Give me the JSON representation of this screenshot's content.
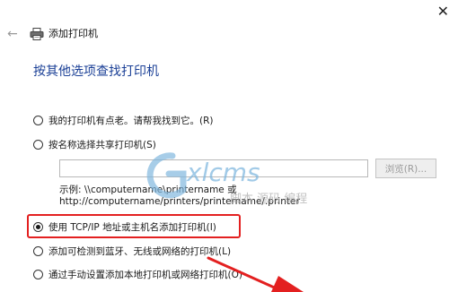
{
  "window": {
    "close_glyph": "✕"
  },
  "header": {
    "back_glyph": "←",
    "title": "添加打印机"
  },
  "main": {
    "heading": "按其他选项查找打印机",
    "options": [
      {
        "label": "我的打印机有点老。请帮我找到它。(R)",
        "checked": false
      },
      {
        "label": "按名称选择共享打印机(S)",
        "checked": false
      },
      {
        "label": "使用 TCP/IP 地址或主机名添加打印机(I)",
        "checked": true
      },
      {
        "label": "添加可检测到蓝牙、无线或网络的打印机(L)",
        "checked": false
      },
      {
        "label": "通过手动设置添加本地打印机或网络打印机(O)",
        "checked": false
      }
    ],
    "shared_printer_input": {
      "value": "",
      "placeholder": ""
    },
    "browse_label": "浏览(R)...",
    "example_line1": "示例: \\\\computername\\printername 或",
    "example_line2": "http://computername/printers/printername/.printer"
  },
  "watermark": {
    "logo_text": "xlcms",
    "sub_text": "脚本 源码 编程"
  },
  "colors": {
    "heading": "#1a3f96",
    "highlight": "#e32020"
  }
}
